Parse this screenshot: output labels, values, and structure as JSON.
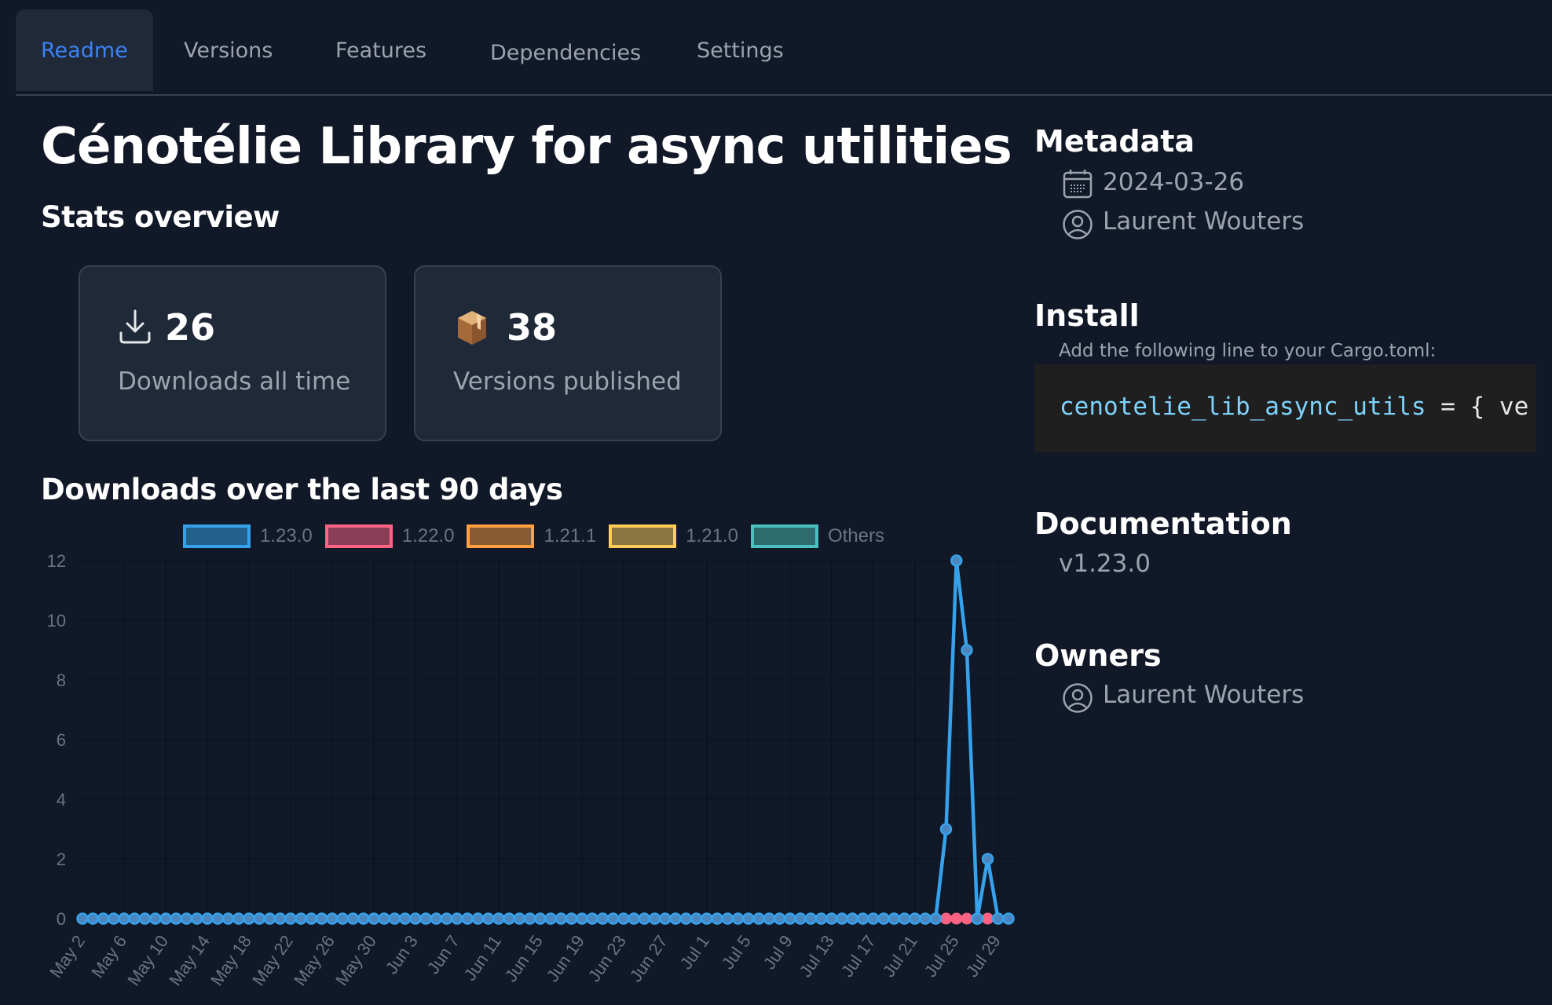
{
  "tabs": [
    {
      "label": "Readme",
      "active": true
    },
    {
      "label": "Versions",
      "active": false
    },
    {
      "label": "Features",
      "active": false
    },
    {
      "label": "Dependencies",
      "active": false
    },
    {
      "label": "Settings",
      "active": false
    }
  ],
  "page": {
    "title": "Cénotélie Library for async utilities",
    "stats_heading": "Stats overview",
    "downloads_heading": "Downloads over the last 90 days"
  },
  "stats": [
    {
      "icon": "download-icon",
      "value": "26",
      "label": "Downloads all time"
    },
    {
      "icon": "package-icon",
      "value": "38",
      "label": "Versions published"
    }
  ],
  "sidebar": {
    "metadata": {
      "heading": "Metadata",
      "date": "2024-03-26",
      "author": "Laurent Wouters"
    },
    "install": {
      "heading": "Install",
      "note": "Add the following line to your Cargo.toml:",
      "code_name": "cenotelie_lib_async_utils",
      "code_rest": " = { ve"
    },
    "documentation": {
      "heading": "Documentation",
      "version": "v1.23.0"
    },
    "owners": {
      "heading": "Owners",
      "items": [
        "Laurent Wouters"
      ]
    }
  },
  "colors": {
    "accent": "#3b82f6",
    "background": "#111827",
    "card": "#1f2937"
  },
  "chart_data": {
    "type": "line",
    "title": "Downloads over the last 90 days",
    "xlabel": "",
    "ylabel": "",
    "ylim": [
      0,
      12
    ],
    "yticks": [
      0,
      2,
      4,
      6,
      8,
      10,
      12
    ],
    "grid": true,
    "legend_position": "top",
    "start_date": "May 2",
    "tick_labels": [
      "May 2",
      "May 6",
      "May 10",
      "May 14",
      "May 18",
      "May 22",
      "May 26",
      "May 30",
      "Jun 3",
      "Jun 7",
      "Jun 11",
      "Jun 15",
      "Jun 19",
      "Jun 23",
      "Jun 27",
      "Jul 1",
      "Jul 5",
      "Jul 9",
      "Jul 13",
      "Jul 17",
      "Jul 21",
      "Jul 25",
      "Jul 29"
    ],
    "tick_every": 4,
    "num_days": 90,
    "series": [
      {
        "name": "1.23.0",
        "border": "#36a2eb",
        "fill": "#24608c",
        "nonzero": {
          "83": 3,
          "84": 12,
          "85": 9,
          "87": 2
        }
      },
      {
        "name": "1.22.0",
        "border": "#ff6384",
        "fill": "#8a3d56",
        "points_visible_days": [
          83,
          84,
          85,
          87
        ],
        "nonzero": {}
      },
      {
        "name": "1.21.1",
        "border": "#ff9f40",
        "fill": "#8a5a30",
        "nonzero": {}
      },
      {
        "name": "1.21.0",
        "border": "#ffcd56",
        "fill": "#8a7540",
        "nonzero": {}
      },
      {
        "name": "Others",
        "border": "#4bc0c0",
        "fill": "#2e6b6f",
        "nonzero": {}
      }
    ]
  }
}
